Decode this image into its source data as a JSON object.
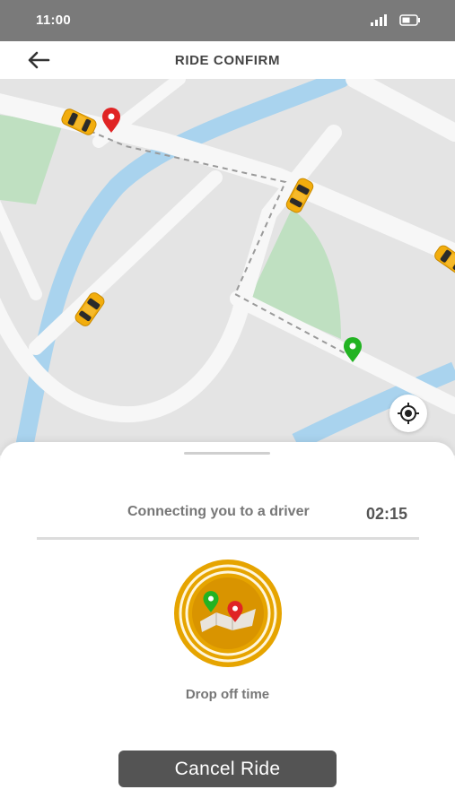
{
  "status_bar": {
    "time": "11:00"
  },
  "header": {
    "title": "RIDE CONFIRM",
    "back_icon": "arrow-left-icon"
  },
  "map": {
    "locate_icon": "crosshair-icon"
  },
  "sheet": {
    "connecting_text": "Connecting you to a driver",
    "timer": "02:15",
    "drop_icon": "drop-off-map-icon",
    "drop_label": "Drop off time",
    "cancel_label": "Cancel Ride"
  },
  "colors": {
    "accent": "#e6a400",
    "dark_button": "#545454",
    "status_bar": "#7a7a7a",
    "pin_red": "#e02424",
    "pin_green": "#22b322"
  }
}
